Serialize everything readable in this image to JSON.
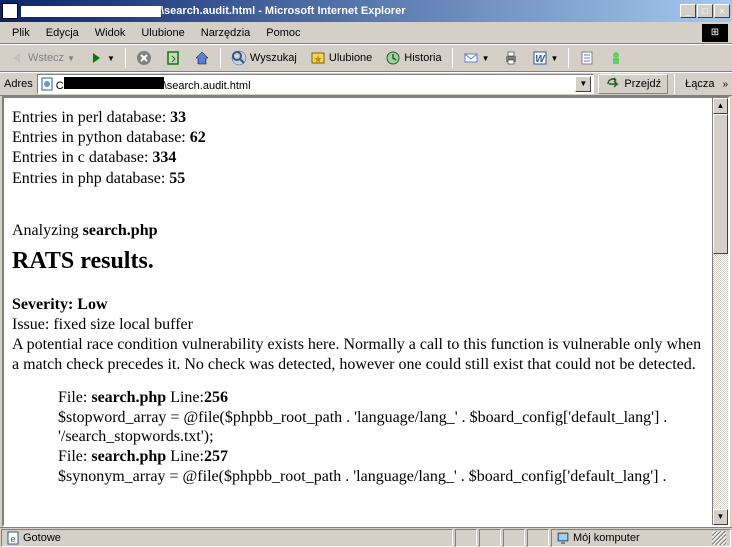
{
  "window": {
    "title_suffix": "\\search.audit.html - Microsoft Internet Explorer",
    "min": "_",
    "max": "□",
    "close": "×"
  },
  "menu": {
    "file": "Plik",
    "edit": "Edycja",
    "view": "Widok",
    "fav": "Ulubione",
    "tools": "Narzędzia",
    "help": "Pomoc"
  },
  "toolbar": {
    "back": "Wstecz",
    "search": "Wyszukaj",
    "fav": "Ulubione",
    "history": "Historia"
  },
  "address": {
    "label": "Adres",
    "url_suffix": "\\search.audit.html",
    "go": "Przejdź",
    "links": "Łącza"
  },
  "page": {
    "entries": {
      "perl_label": "Entries in perl database: ",
      "perl_count": "33",
      "python_label": "Entries in python database: ",
      "python_count": "62",
      "c_label": "Entries in c database: ",
      "c_count": "334",
      "php_label": "Entries in php database: ",
      "php_count": "55"
    },
    "analyzing_pre": "Analyzing ",
    "analyzing_file": "search.php",
    "heading": "RATS results.",
    "severity": "Severity: Low",
    "issue": "Issue: fixed size local buffer",
    "desc": "A potential race condition vulnerability exists here. Normally a call to this function is vulnerable only when a match check precedes it. No check was detected, however one could still exist that could not be detected.",
    "code": {
      "f1_pre": "File: ",
      "f1_file": "search.php",
      "f1_mid": " Line:",
      "f1_line": "256",
      "l1": "$stopword_array = @file($phpbb_root_path . 'language/lang_' . $board_config['default_lang'] . '/search_stopwords.txt');",
      "f2_pre": "File: ",
      "f2_file": "search.php",
      "f2_mid": " Line:",
      "f2_line": "257",
      "l2": "$synonym_array = @file($phpbb_root_path . 'language/lang_' . $board_config['default_lang'] ."
    }
  },
  "status": {
    "done": "Gotowe",
    "zone": "Mój komputer"
  }
}
